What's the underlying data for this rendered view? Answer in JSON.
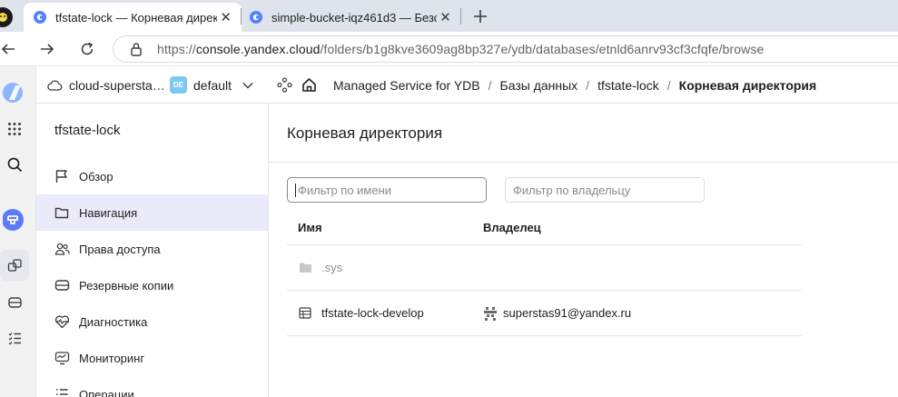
{
  "browser": {
    "tabs": [
      {
        "title": "tfstate-lock — Корневая директо",
        "active": true
      },
      {
        "title": "simple-bucket-iqz461d3 — Безоп",
        "active": false
      }
    ],
    "url_prefix": "https://",
    "url_host": "console.yandex.cloud",
    "url_path": "/folders/b1g8kve3609ag8bp327e/ydb/databases/etnld6anrv93cf3cfqfe/browse"
  },
  "header": {
    "cloud": "cloud-supersta…",
    "folder_badge": "DE",
    "folder": "default",
    "breadcrumbs": [
      {
        "label": "Managed Service for YDB"
      },
      {
        "label": "Базы данных"
      },
      {
        "label": "tfstate-lock"
      },
      {
        "label": "Корневая директория"
      }
    ],
    "separator": "/"
  },
  "sidebar": {
    "title": "tfstate-lock",
    "items": [
      {
        "label": "Обзор",
        "icon": "flag-icon"
      },
      {
        "label": "Навигация",
        "icon": "folder-icon",
        "active": true
      },
      {
        "label": "Права доступа",
        "icon": "users-icon"
      },
      {
        "label": "Резервные копии",
        "icon": "backup-icon"
      },
      {
        "label": "Диагностика",
        "icon": "heartbeat-icon"
      },
      {
        "label": "Мониторинг",
        "icon": "monitor-icon"
      },
      {
        "label": "Операции",
        "icon": "list-icon"
      }
    ]
  },
  "main": {
    "title": "Корневая директория",
    "filter_name_placeholder": "Фильтр по имени",
    "filter_owner_placeholder": "Фильтр по владельцу",
    "columns": {
      "name": "Имя",
      "owner": "Владелец"
    },
    "rows": [
      {
        "name": ".sys",
        "owner": "",
        "type": "folder",
        "muted": true
      },
      {
        "name": "tfstate-lock-develop",
        "owner": "superstas91@yandex.ru",
        "type": "table"
      }
    ]
  },
  "colors": {
    "accent": "#5282ff",
    "active_nav_bg": "#e9eafa",
    "tabbar_bg": "#dfe3eb"
  }
}
